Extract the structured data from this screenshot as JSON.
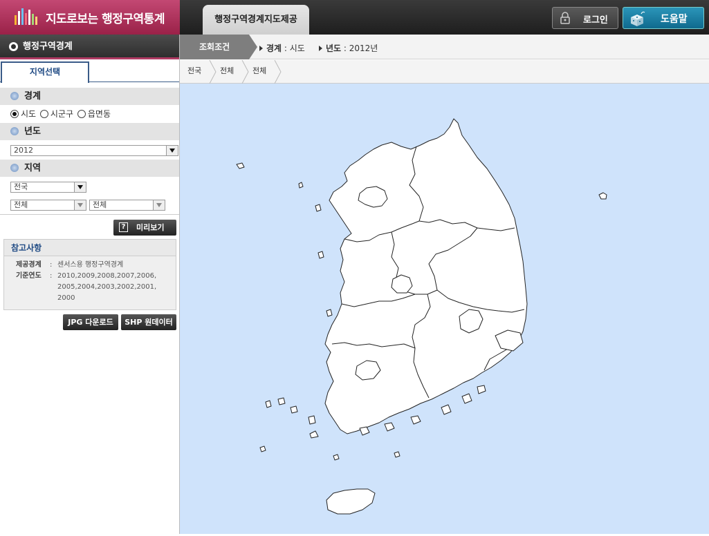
{
  "header": {
    "logo_text": "지도로보는 행정구역통계",
    "main_tab": "행정구역경계지도제공",
    "login_label": "로그인",
    "help_label": "도움말"
  },
  "sidebar": {
    "menu_title": "행정구역경계",
    "tab_label": "지역선택",
    "boundary": {
      "title": "경계",
      "options": [
        "시도",
        "시군구",
        "읍면동"
      ],
      "selected": "시도"
    },
    "year": {
      "title": "년도",
      "selected": "2012"
    },
    "region": {
      "title": "지역",
      "level1": "전국",
      "level2": "전체",
      "level3": "전체"
    },
    "preview_label": "미리보기",
    "reference": {
      "title": "참고사항",
      "rows": [
        {
          "key": "제공경계",
          "value": "센서스용 행정구역경계"
        },
        {
          "key": "기준연도",
          "value": "2010,2009,2008,2007,2006,2005,2004,2003,2002,2001,2000"
        }
      ]
    },
    "jpg_download_label": "JPG 다운로드",
    "shp_label": "SHP 원데이터"
  },
  "conditions": {
    "label": "조회조건",
    "boundary_key": "경계",
    "boundary_value": "시도",
    "year_key": "년도",
    "year_value": "2012년"
  },
  "breadcrumb": [
    "전국",
    "전체",
    "전체"
  ],
  "colors": {
    "map_sea": "#cfe3fb",
    "map_land": "#ffffff",
    "logo_bg": "#b03a63",
    "help_button": "#1a7fa3"
  }
}
